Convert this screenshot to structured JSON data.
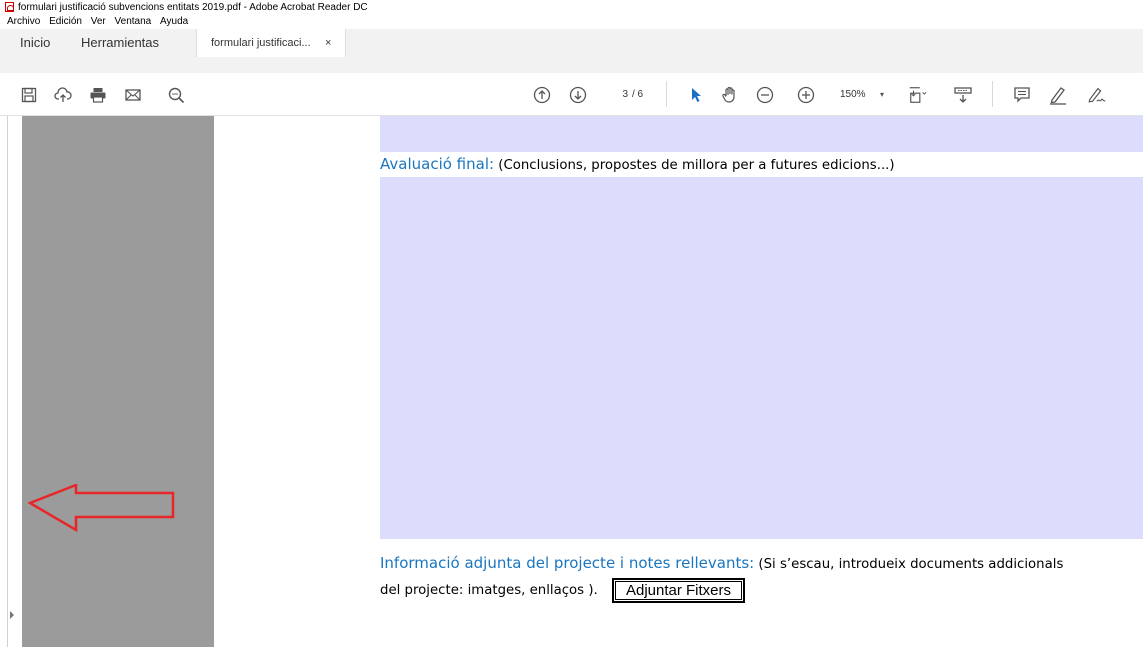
{
  "window": {
    "title": "formulari justificació subvencions entitats 2019.pdf - Adobe Acrobat Reader DC"
  },
  "menu": {
    "items": [
      "Archivo",
      "Edición",
      "Ver",
      "Ventana",
      "Ayuda"
    ]
  },
  "tabs": {
    "home": "Inicio",
    "tools": "Herramientas",
    "document": "formulari justificaci...",
    "close": "×"
  },
  "toolbar": {
    "page_current": "3",
    "page_total": "/ 6",
    "zoom": "150%",
    "zoom_caret": "▾",
    "icons": [
      "save-icon",
      "upload-icon",
      "print-icon",
      "email-icon",
      "search-icon",
      "page-up-icon",
      "page-down-icon",
      "select-cursor-icon",
      "hand-icon",
      "zoom-out-icon",
      "zoom-in-icon",
      "page-fit-icon",
      "scroll-mode-icon",
      "comment-icon",
      "highlight-pen-icon",
      "sign-icon"
    ]
  },
  "document": {
    "section1": {
      "title": "Avaluació final:",
      "note": " (Conclusions, propostes de millora per a futures edicions...)"
    },
    "section2": {
      "title": "Informació adjunta del projecte i notes rellevants:",
      "note": " (Si s’escau, introdueix documents addicionals",
      "note_cont": "del projecte: imatges, enllaços )."
    },
    "attach_button": "Adjuntar Fitxers"
  },
  "colors": {
    "field_fill": "#dcdcfc",
    "heading_blue": "#1a76c0",
    "nav_panel": "#9b9b9b",
    "annotation_arrow": "#e8262a"
  }
}
